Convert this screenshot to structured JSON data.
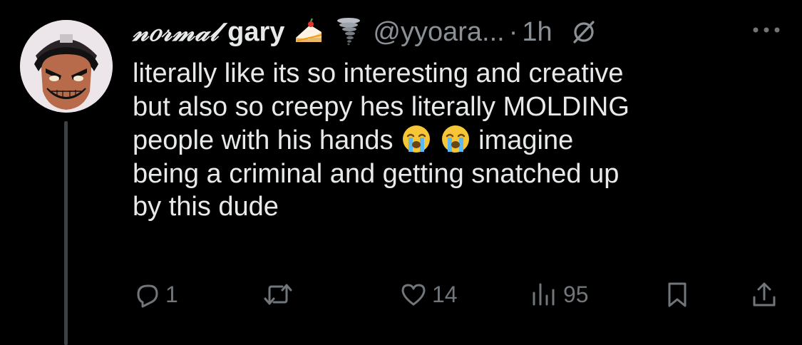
{
  "tweet": {
    "display_name_styled": "𝓃𝑜𝓇𝓂𝒶𝓁",
    "display_name_plain": "gary",
    "name_emojis": [
      "cake-emoji",
      "tornado-emoji"
    ],
    "handle": "@yyoara...",
    "separator": "·",
    "time": "1h",
    "text_lines": [
      "literally like its so interesting and creative",
      "but also so creepy hes literally MOLDING",
      "people with his hands",
      "imagine",
      "being a criminal and getting snatched up",
      "by this dude"
    ],
    "inline_emojis": [
      "loudly-crying-face-emoji",
      "loudly-crying-face-emoji"
    ]
  },
  "actions": {
    "reply_count": "1",
    "retweet_count": "",
    "like_count": "14",
    "views_count": "95"
  },
  "colors": {
    "background": "#000000",
    "text": "#e7e9ea",
    "muted": "#71767b",
    "thread_line": "#3e4144"
  }
}
